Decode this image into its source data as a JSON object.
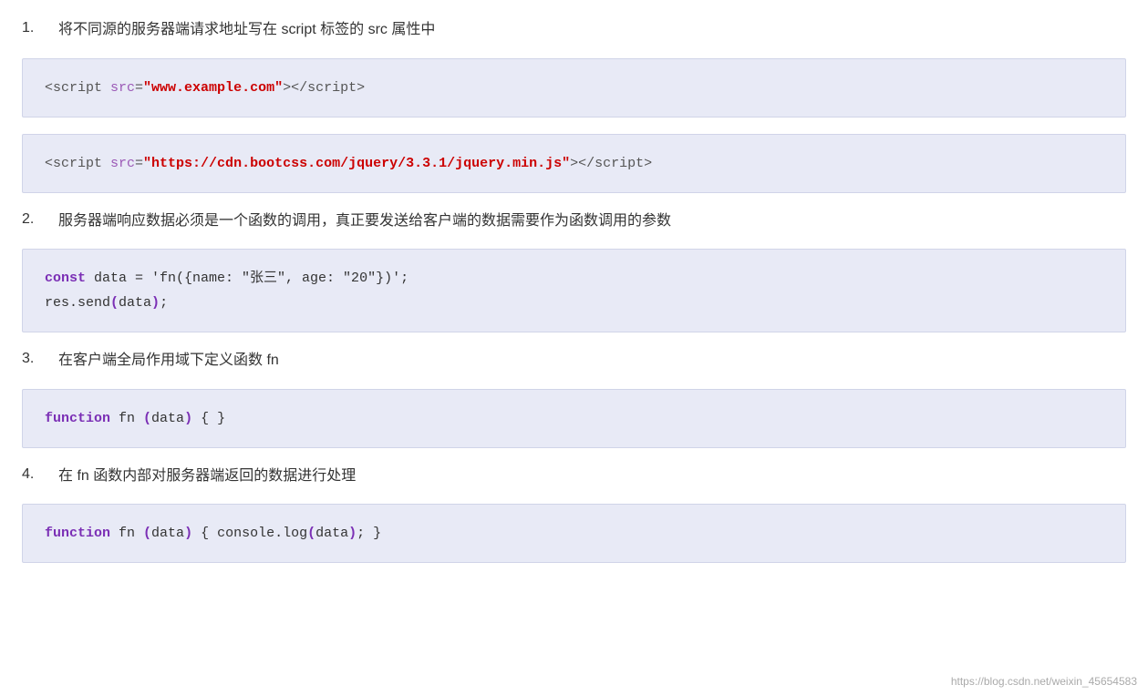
{
  "steps": [
    {
      "number": "1.",
      "text": "将不同源的服务器端请求地址写在 script 标签的 src 属性中"
    },
    {
      "number": "2.",
      "text": "服务器端响应数据必须是一个函数的调用，真正要发送给客户端的数据需要作为函数调用的参数"
    },
    {
      "number": "3.",
      "text": "在客户端全局作用域下定义函数 fn"
    },
    {
      "number": "4.",
      "text": "在 fn 函数内部对服务器端返回的数据进行处理"
    }
  ],
  "code_blocks": [
    {
      "id": "cb1",
      "lines": [
        "<script src=\"www.example.com\"><\\/script>"
      ]
    },
    {
      "id": "cb2",
      "lines": [
        "<script src=\"https://cdn.bootcss.com/jquery/3.3.1/jquery.min.js\"><\\/script>"
      ]
    },
    {
      "id": "cb3",
      "lines": [
        "const data = 'fn({name: \"张三\", age: \"20\"})';"
      ],
      "lines2": [
        "res.send(data);"
      ]
    },
    {
      "id": "cb4",
      "lines": [
        "function fn (data) { }"
      ]
    },
    {
      "id": "cb5",
      "lines": [
        "function fn (data) { console.log(data); }"
      ]
    }
  ],
  "watermark": "https://blog.csdn.net/weixin_45654583"
}
